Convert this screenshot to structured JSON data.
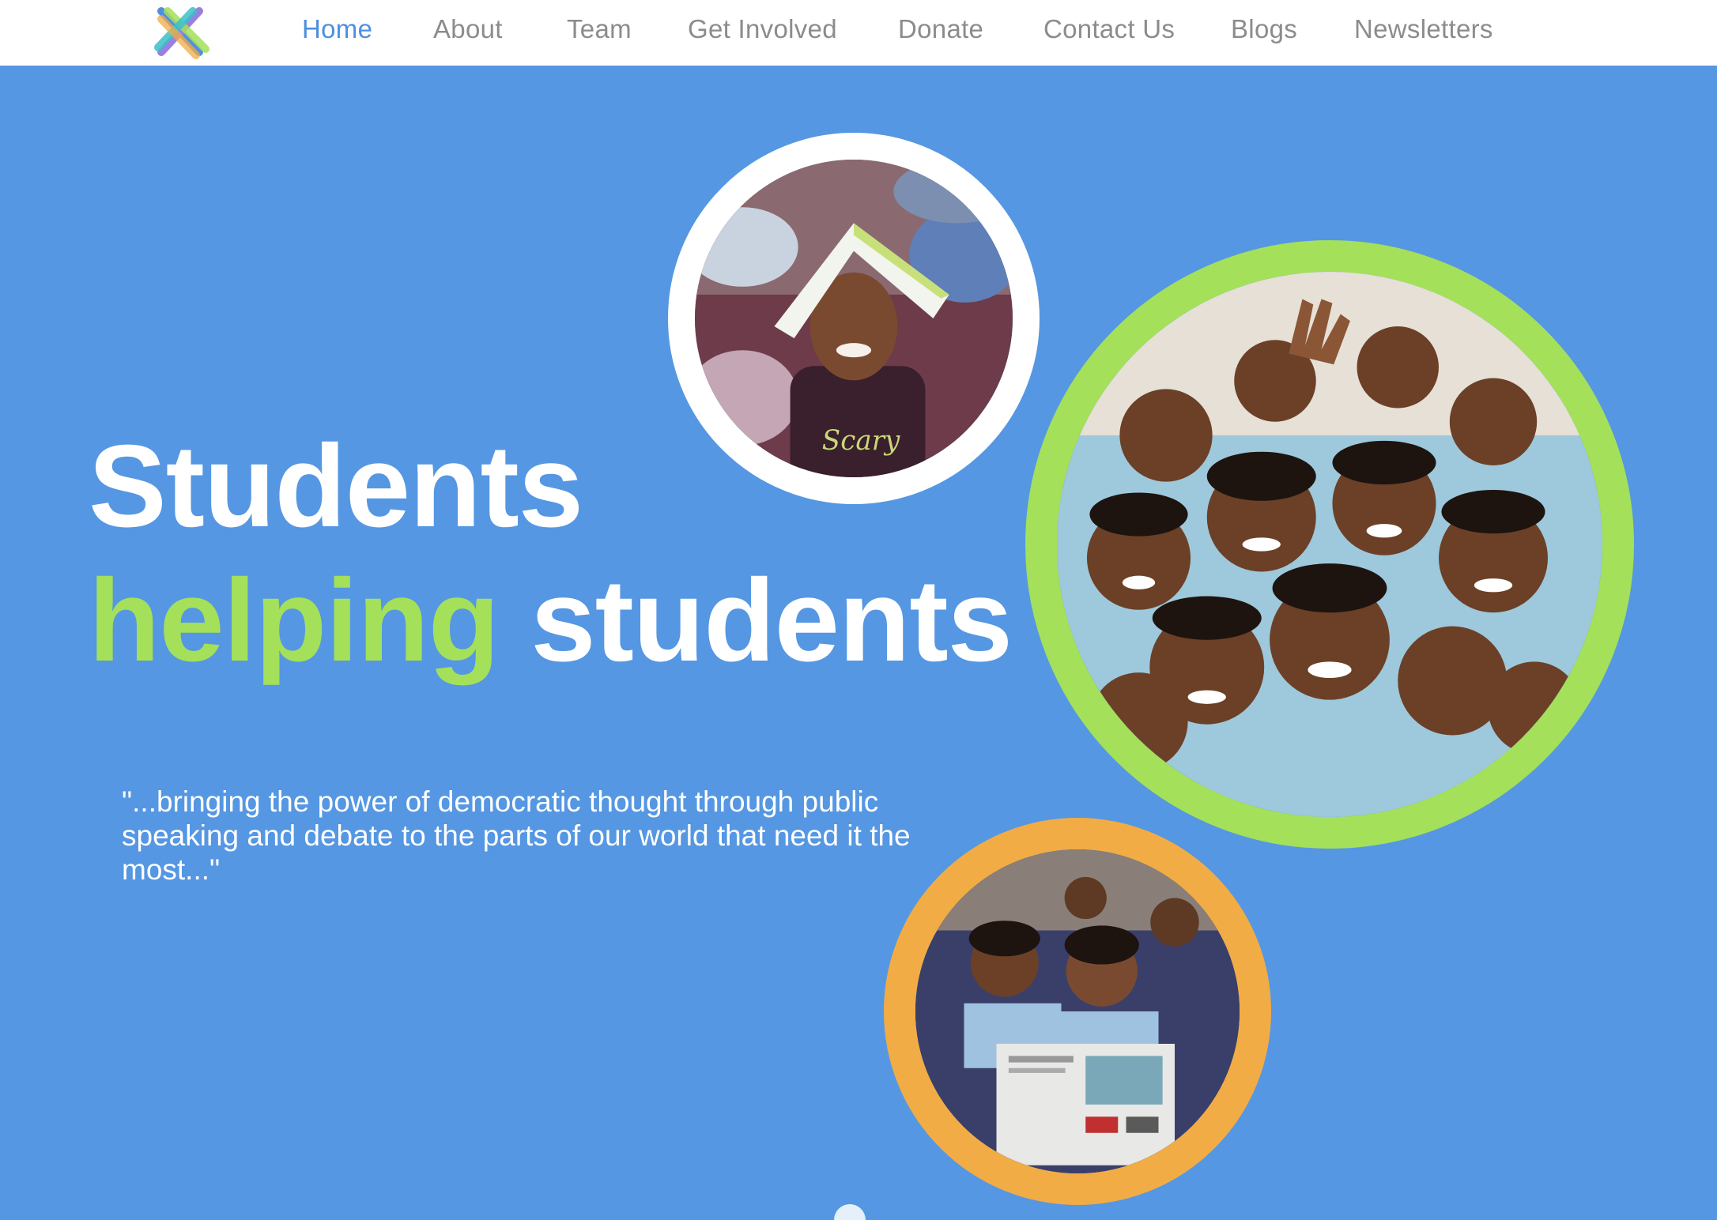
{
  "nav": {
    "logo_icon": "multicolor-x-logo",
    "items": [
      {
        "label": "Home",
        "active": true
      },
      {
        "label": "About",
        "active": false
      },
      {
        "label": "Team",
        "active": false
      },
      {
        "label": "Get Involved",
        "active": false
      },
      {
        "label": "Donate",
        "active": false
      },
      {
        "label": "Contact Us",
        "active": false
      },
      {
        "label": "Blogs",
        "active": false
      },
      {
        "label": "Newsletters",
        "active": false
      }
    ]
  },
  "hero": {
    "headline_line1": "Students",
    "headline_accent": "helping",
    "headline_rest": " students",
    "quote": "\"...bringing the power of democratic thought through public speaking and debate to the parts of our world that need it the most...\""
  },
  "photos": [
    {
      "name": "boy-with-book-on-head-photo",
      "ring_color": "#ffffff"
    },
    {
      "name": "group-of-smiling-students-photo",
      "ring_color": "#a4e05a"
    },
    {
      "name": "girls-reading-newspaper-photo",
      "ring_color": "#f2ac45"
    }
  ],
  "colors": {
    "background": "#5597e2",
    "nav_active": "#4f8fde",
    "nav_inactive": "#8c8c8c",
    "accent_green": "#a4e05a",
    "accent_orange": "#f2ac45"
  }
}
